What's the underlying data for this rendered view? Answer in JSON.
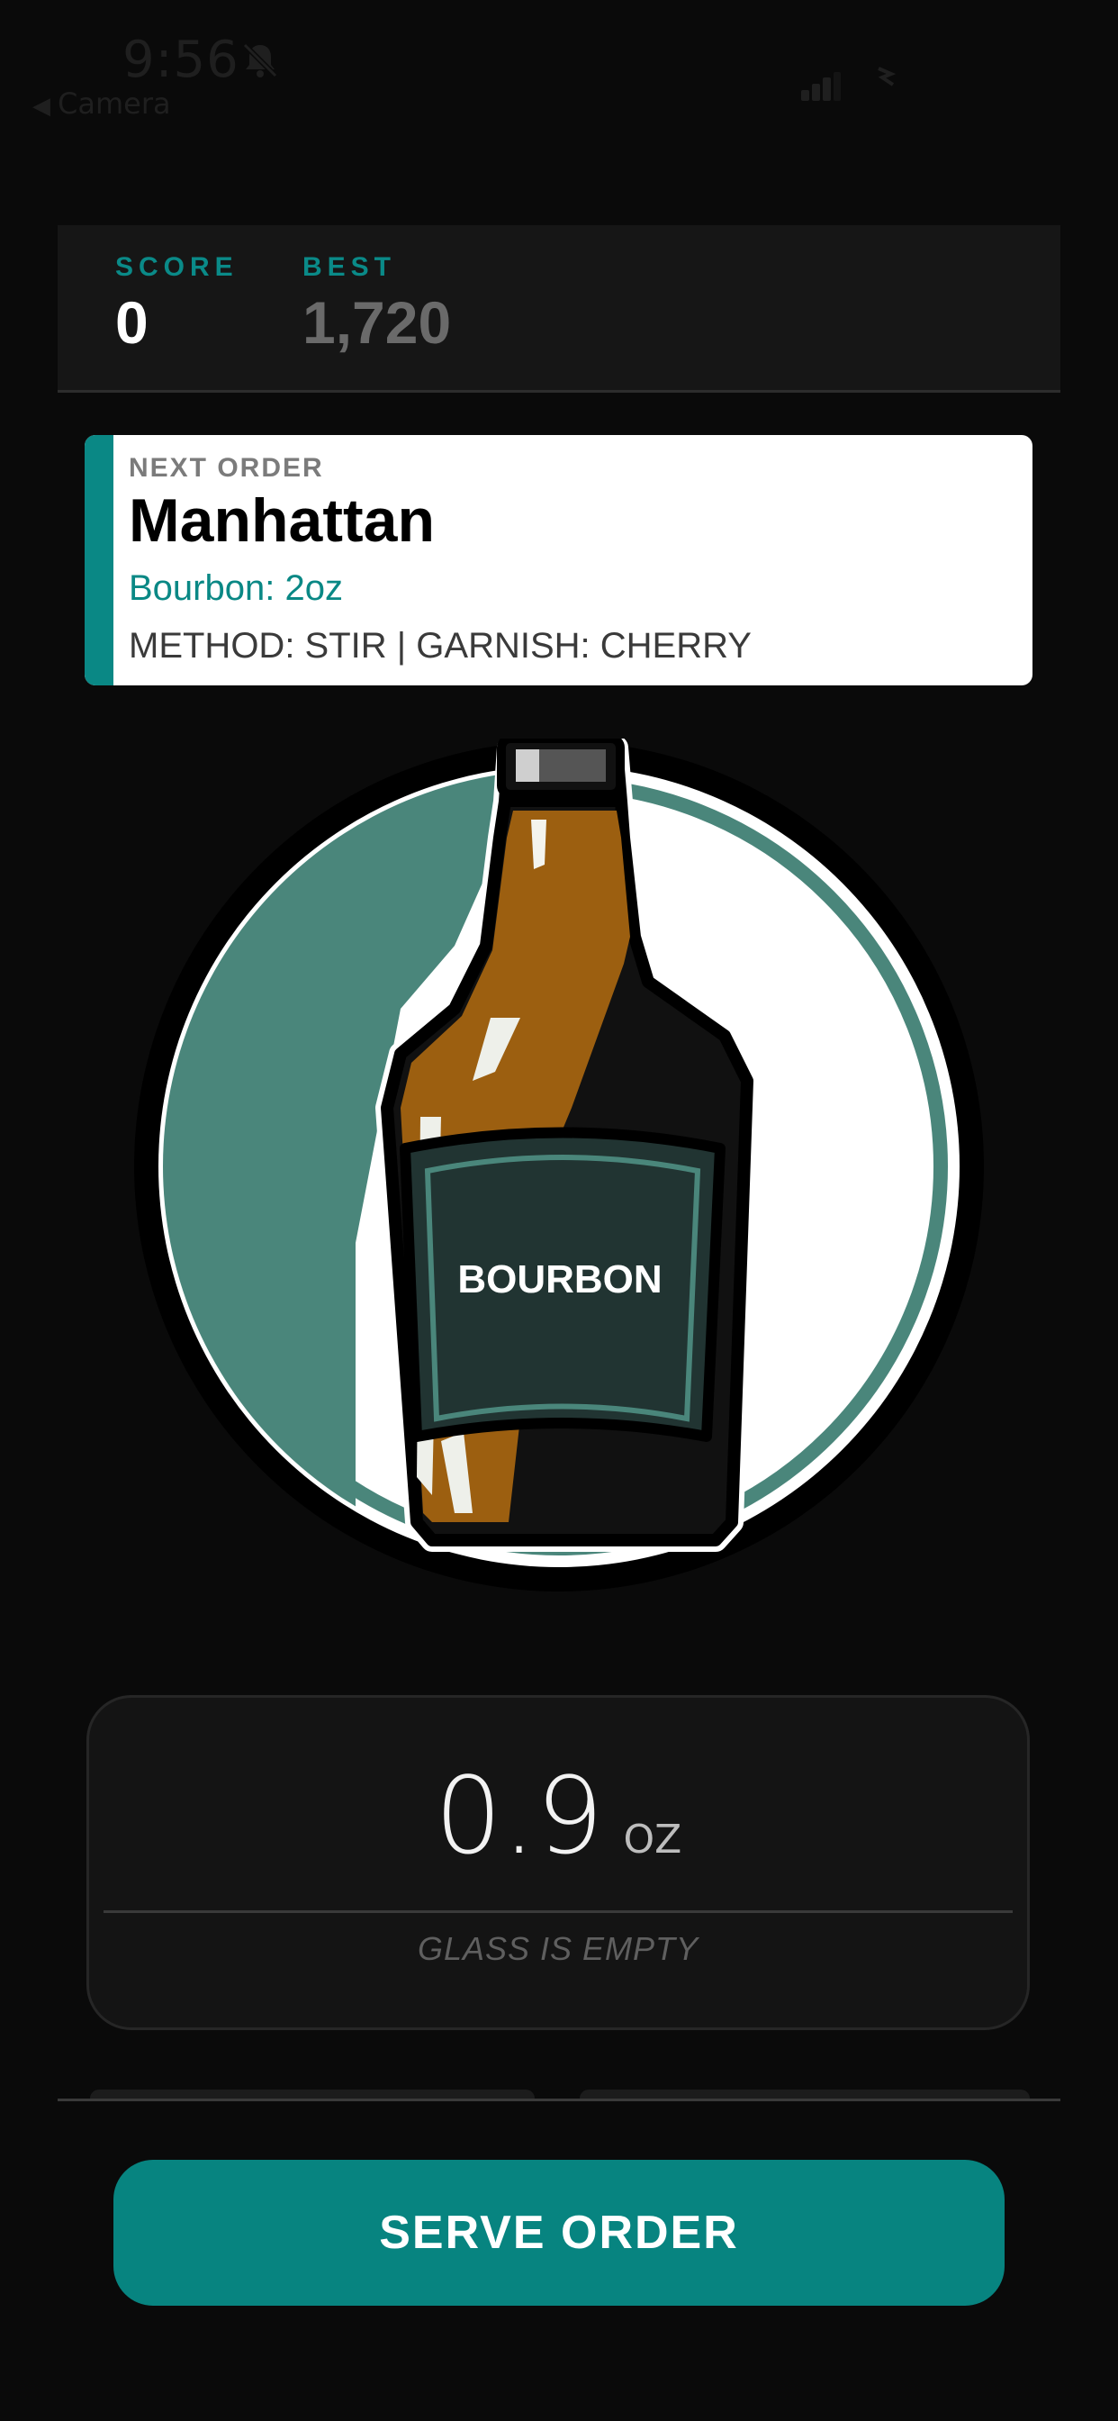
{
  "status_bar": {
    "time": "9:56",
    "back_label": "Camera",
    "icons": [
      "bell-slash-icon",
      "signal-icon",
      "wifi-icon"
    ]
  },
  "scoreboard": {
    "score_label": "SCORE",
    "score_value": "0",
    "best_label": "BEST",
    "best_value": "1,720"
  },
  "order": {
    "kicker": "NEXT ORDER",
    "name": "Manhattan",
    "ingredient": "Bourbon: 2oz",
    "method": "METHOD: STIR | GARNISH: CHERRY"
  },
  "bottle": {
    "label": "BOURBON",
    "fill_fraction": 0.45
  },
  "measure": {
    "amount": "0.9",
    "unit": "OZ",
    "status": "GLASS IS EMPTY"
  },
  "actions": {
    "serve_label": "SERVE ORDER"
  },
  "colors": {
    "accent": "#0a8885",
    "background": "#0a0a0a",
    "bourbon": "#9c5f10",
    "teal_circle": "#4a867b",
    "label_dark": "#213432"
  }
}
